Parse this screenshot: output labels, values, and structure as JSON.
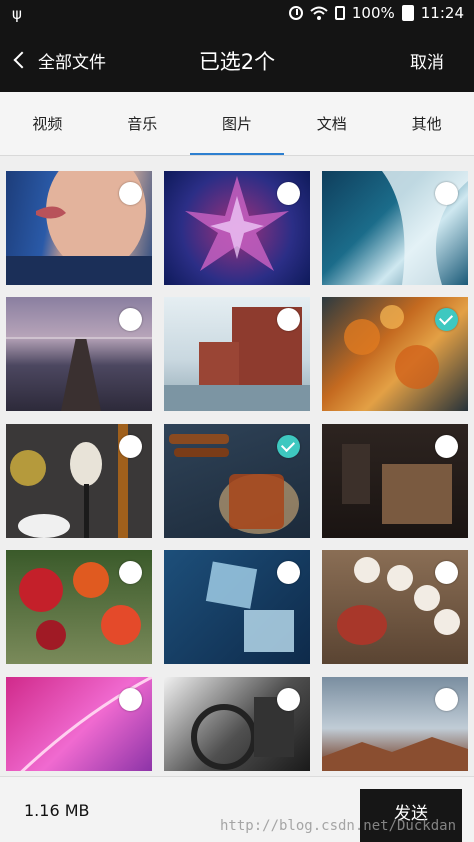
{
  "status_bar": {
    "battery_percent": "100%",
    "time": "11:24",
    "icons": [
      "usb-icon",
      "alarm-icon",
      "wifi-icon",
      "sim-icon",
      "battery-icon"
    ]
  },
  "header": {
    "back_label": "全部文件",
    "title": "已选2个",
    "cancel_label": "取消"
  },
  "tabs": [
    {
      "label": "视频",
      "selected": false
    },
    {
      "label": "音乐",
      "selected": false
    },
    {
      "label": "图片",
      "selected": true
    },
    {
      "label": "文档",
      "selected": false
    },
    {
      "label": "其他",
      "selected": false
    }
  ],
  "photos": [
    {
      "subject": "portrait-face",
      "checked": false
    },
    {
      "subject": "crystal-flower",
      "checked": false
    },
    {
      "subject": "ocean-waves",
      "checked": false
    },
    {
      "subject": "sea-pier",
      "checked": false
    },
    {
      "subject": "waterfront-buildings",
      "checked": false
    },
    {
      "subject": "autumn-leaves",
      "checked": true
    },
    {
      "subject": "spices-spoons",
      "checked": false
    },
    {
      "subject": "tea-cinnamon",
      "checked": true
    },
    {
      "subject": "room-chair",
      "checked": false
    },
    {
      "subject": "flower-bouquet",
      "checked": false
    },
    {
      "subject": "ice-cubes",
      "checked": false
    },
    {
      "subject": "tea-set",
      "checked": false
    },
    {
      "subject": "pink-feather",
      "checked": false
    },
    {
      "subject": "engine-bw",
      "checked": false
    },
    {
      "subject": "canyon-sky",
      "checked": false
    }
  ],
  "footer": {
    "total_size": "1.16 MB",
    "send_label": "发送"
  },
  "watermark": "http://blog.csdn.net/Duckdan",
  "colors": {
    "header_bg": "#141414",
    "tab_indicator": "#2d7fd0",
    "check_selected": "#3ec8c0"
  }
}
